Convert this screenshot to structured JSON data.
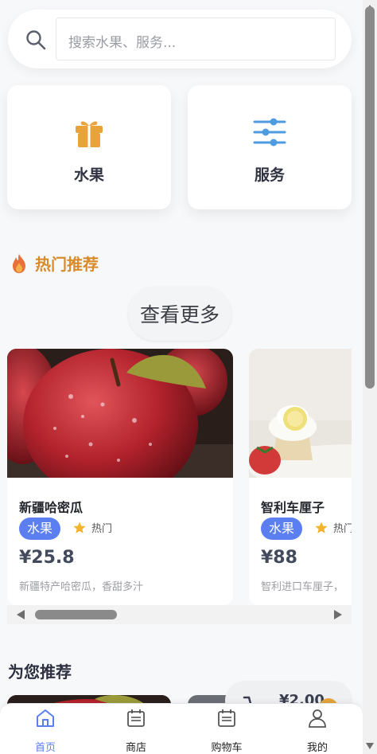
{
  "search": {
    "placeholder": "搜索水果、服务..."
  },
  "categories": [
    {
      "label": "水果",
      "icon": "gift-icon",
      "color": "#e8a43a"
    },
    {
      "label": "服务",
      "icon": "sliders-icon",
      "color": "#4e9be0"
    }
  ],
  "hot": {
    "title": "热门推荐",
    "icon": "fire-icon",
    "more_label": "查看更多"
  },
  "products": [
    {
      "name": "新疆哈密瓜",
      "tag": "水果",
      "hot_label": "热门",
      "price": "¥25.8",
      "desc": "新疆特产哈密瓜，香甜多汁",
      "image": "apple-photo"
    },
    {
      "name": "智利车厘子",
      "tag": "水果",
      "hot_label": "热门",
      "price": "¥88",
      "desc": "智利进口车厘子，",
      "image": "dessert-photo"
    }
  ],
  "recommend": {
    "title": "为您推荐"
  },
  "cart_float": {
    "price": "¥2.00"
  },
  "nav": [
    {
      "label": "首页",
      "icon": "home-icon",
      "active": true
    },
    {
      "label": "商店",
      "icon": "calendar-icon",
      "active": false
    },
    {
      "label": "购物车",
      "icon": "calendar-icon",
      "active": false
    },
    {
      "label": "我的",
      "icon": "user-icon",
      "active": false
    }
  ],
  "colors": {
    "accent": "#5b7ef0",
    "hot": "#d98a2a",
    "star": "#f2b42c"
  }
}
